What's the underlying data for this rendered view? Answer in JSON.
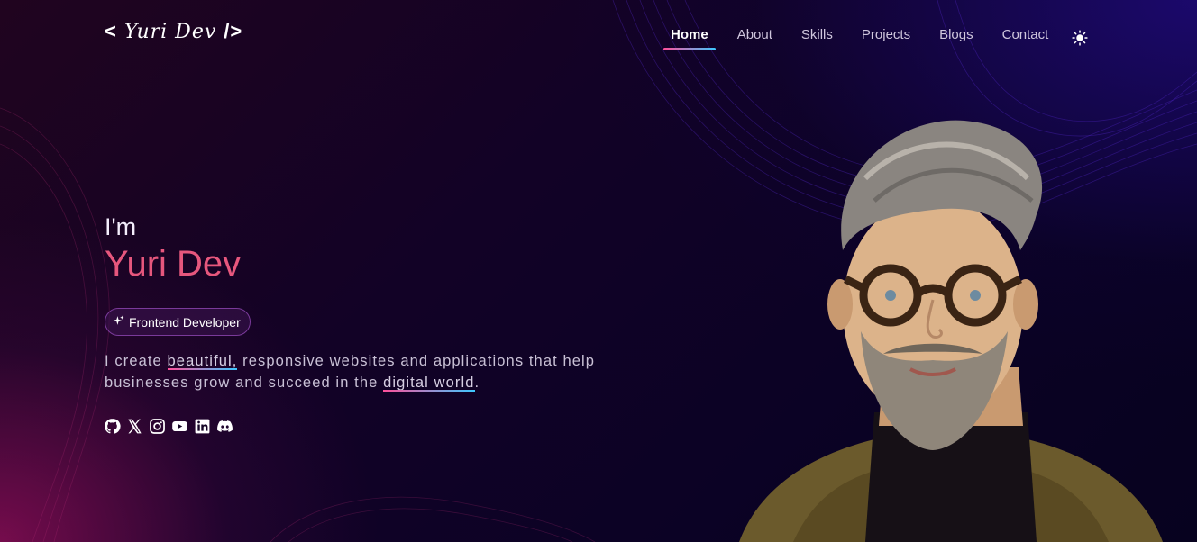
{
  "header": {
    "logo_open": "<",
    "logo_text": "Yuri Dev",
    "logo_close": "/>",
    "nav": [
      {
        "label": "Home",
        "active": true
      },
      {
        "label": "About"
      },
      {
        "label": "Skills"
      },
      {
        "label": "Projects"
      },
      {
        "label": "Blogs"
      },
      {
        "label": "Contact"
      }
    ],
    "theme_icon": "sun-icon"
  },
  "hero": {
    "greeting": "I'm",
    "name": "Yuri Dev",
    "badge": {
      "icon": "sparkle-icon",
      "label": "Frontend Developer"
    },
    "description": {
      "part1": "I create ",
      "highlight1": "beautiful,",
      "part2": " responsive websites and applications that help businesses grow and succeed in the ",
      "highlight2": "digital world",
      "part3": "."
    },
    "socials": [
      "github-icon",
      "x-icon",
      "instagram-icon",
      "youtube-icon",
      "linkedin-icon",
      "discord-icon"
    ]
  },
  "colors": {
    "accent_pink": "#e6577d",
    "gradient_start": "#ff4f9a",
    "gradient_end": "#3cc8ff",
    "background": "#0b0220"
  }
}
